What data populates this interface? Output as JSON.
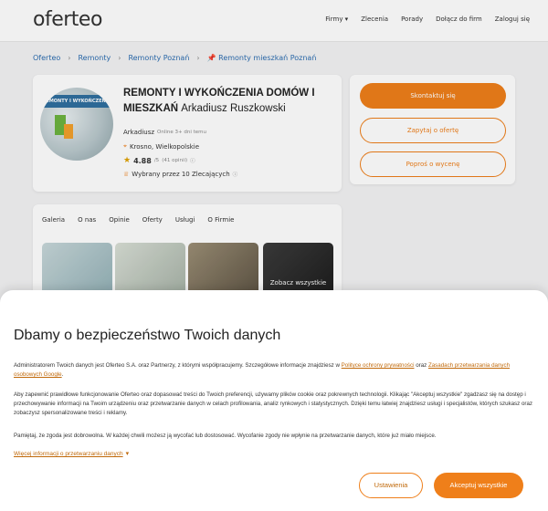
{
  "header": {
    "logo": "oferteo",
    "nav": [
      "Firmy ▾",
      "Zlecenia",
      "Porady",
      "Dołącz do firm",
      "Zaloguj się"
    ]
  },
  "breadcrumbs": [
    "Oferteo",
    "Remonty",
    "Remonty Poznań",
    "📌 Remonty mieszkań Poznań"
  ],
  "profile": {
    "title_bold": "REMONTY I WYKOŃCZENIA DOMÓW I MIESZKAŃ",
    "title_name": "Arkadiusz Ruszkowski",
    "owner": "Arkadiusz",
    "online": "Online 3+ dni temu",
    "location": "Krosno, Wielkopolskie",
    "rating": "4.88",
    "rating_max": "/5",
    "reviews": "(41 opinii)",
    "chosen": "Wybrany przez 10 Zlecających",
    "avatar_text": "REMONTY I WYKOŃCZENIA"
  },
  "actions": {
    "contact": "Skontaktuj się",
    "ask_offer": "Zapytaj o ofertę",
    "ask_price": "Poproś o wycenę"
  },
  "tabs": [
    "Galeria",
    "O nas",
    "Opinie",
    "Oferty",
    "Usługi",
    "O Firmie"
  ],
  "gallery": {
    "see_all": "Zobacz wszystkie"
  },
  "cookie": {
    "title": "Dbamy o bezpieczeństwo Twoich danych",
    "p1_a": "Administratorem Twoich danych jest Oferteo S.A. oraz Partnerzy, z którymi współpracujemy. Szczegółowe informacje znajdziesz w ",
    "p1_link1": "Polityce ochrony prywatności",
    "p1_b": " oraz ",
    "p1_link2": "Zasadach przetwarzania danych osobowych Google",
    "p1_c": ".",
    "p2": "Aby zapewnić prawidłowe funkcjonowanie Oferteo oraz dopasować treści do Twoich preferencji, używamy plików cookie oraz pokrewnych technologii. Klikając \"Akceptuj wszystkie\" zgadzasz się na dostęp i przechowywanie informacji na Twoim urządzeniu oraz przetwarzanie danych w celach profilowania, analiz rynkowych i statystycznych. Dzięki temu łatwiej znajdziesz usługi i specjalistów, których szukasz oraz zobaczysz spersonalizowane treści i reklamy.",
    "p3": "Pamiętaj, że zgoda jest dobrowolna. W każdej chwili możesz ją wycofać lub dostosować. Wycofanie zgody nie wpłynie na przetwarzanie danych, które już miało miejsce.",
    "more": "Więcej informacji o przetwarzaniu danych",
    "settings": "Ustawienia",
    "accept": "Akceptuj wszystkie"
  }
}
